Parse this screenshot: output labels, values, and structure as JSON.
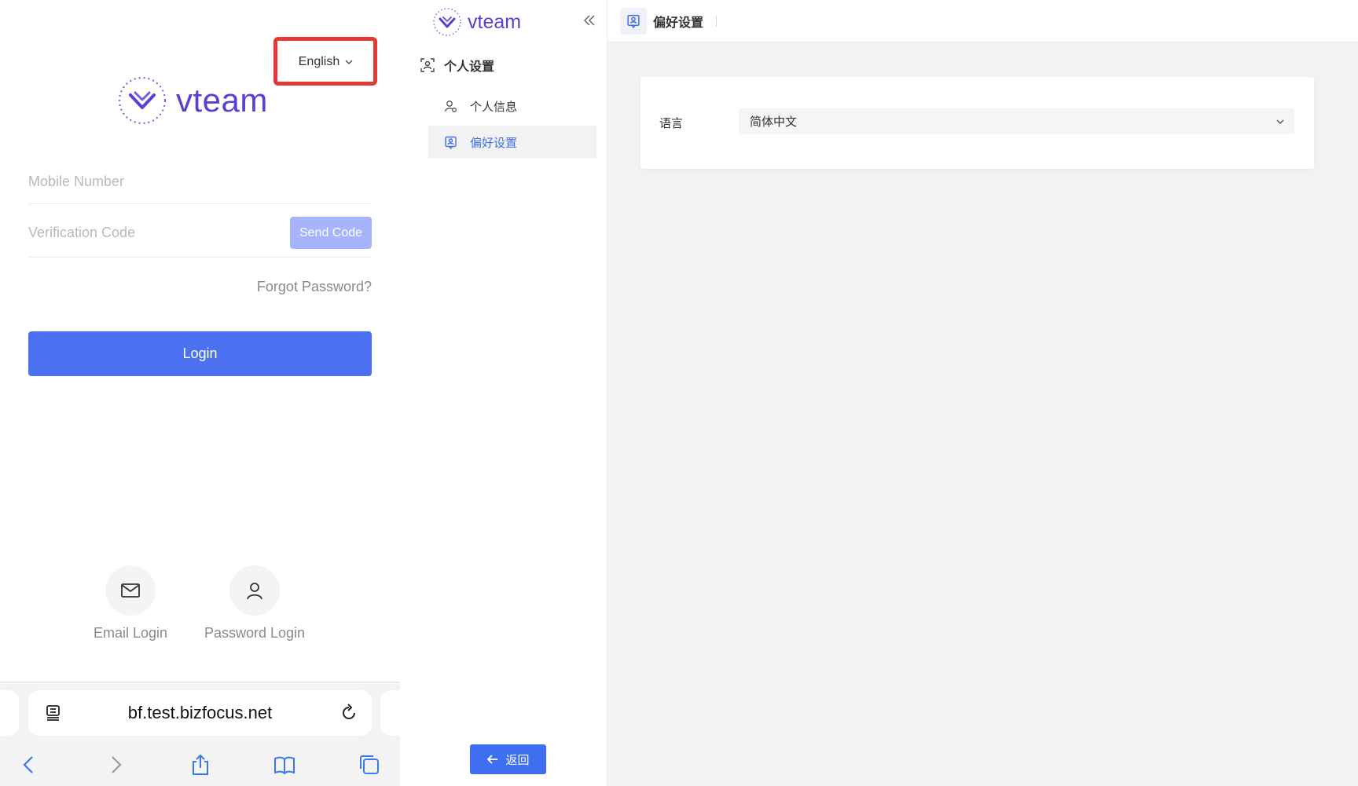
{
  "mobile": {
    "language_switch": "English",
    "brand": "vteam",
    "mobile_placeholder": "Mobile Number",
    "code_placeholder": "Verification Code",
    "send_code": "Send Code",
    "forgot_password": "Forgot Password?",
    "login": "Login",
    "alt_logins": [
      {
        "label": "Email Login",
        "icon": "mail-icon"
      },
      {
        "label": "Password Login",
        "icon": "user-icon"
      }
    ],
    "browser": {
      "url": "bf.test.bizfocus.net"
    }
  },
  "desktop": {
    "brand": "vteam",
    "sidebar": {
      "group": "个人设置",
      "items": [
        {
          "label": "个人信息",
          "active": false
        },
        {
          "label": "偏好设置",
          "active": true
        }
      ],
      "back": "返回"
    },
    "topbar": {
      "title": "偏好设置"
    },
    "preferences": {
      "language_label": "语言",
      "language_value": "简体中文"
    }
  },
  "colors": {
    "brand_purple": "#5a3fd6",
    "primary_blue": "#4c71f0",
    "highlight_red": "#e53935",
    "send_code_bg": "#a5b4fb"
  }
}
